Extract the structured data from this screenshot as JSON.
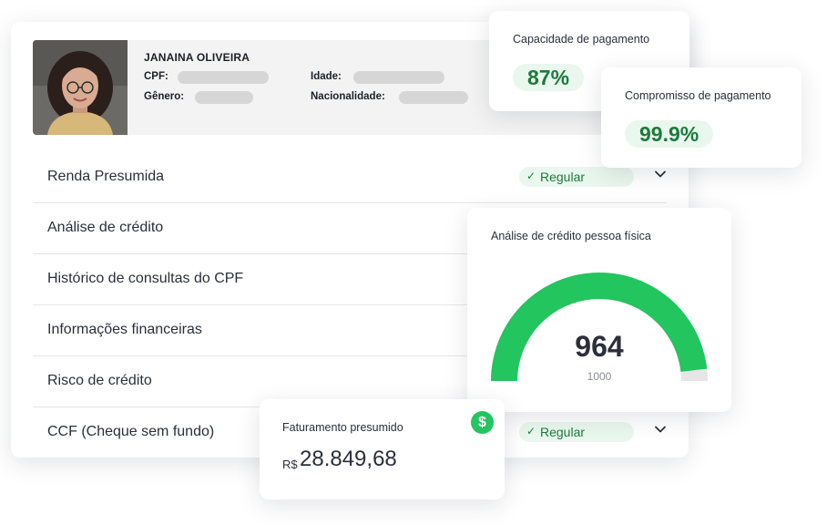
{
  "profile": {
    "name": "JANAINA OLIVEIRA",
    "cpf_label": "CPF:",
    "idade_label": "Idade:",
    "genero_label": "Gênero:",
    "nacionalidade_label": "Nacionalidade:"
  },
  "sections": [
    {
      "label": "Renda Presumida",
      "status": "Regular"
    },
    {
      "label": "Análise de crédito"
    },
    {
      "label": "Histórico de consultas do CPF"
    },
    {
      "label": "Informações financeiras"
    },
    {
      "label": "Risco de crédito"
    },
    {
      "label": "CCF (Cheque sem fundo)",
      "status": "Regular"
    }
  ],
  "capacidade": {
    "title": "Capacidade de pagamento",
    "value": "87%"
  },
  "compromisso": {
    "title": "Compromisso de pagamento",
    "value": "99.9%"
  },
  "gauge": {
    "title": "Análise de crédito pessoa física",
    "value": "964",
    "max": "1000",
    "score": 964,
    "max_score": 1000
  },
  "faturamento": {
    "title": "Faturamento presumido",
    "currency": "R$",
    "amount": "28.849,68",
    "icon": "dollar-icon"
  },
  "colors": {
    "accent_green": "#22c55e",
    "badge_bg": "#e9f7ee",
    "badge_text": "#1c7c3b"
  }
}
